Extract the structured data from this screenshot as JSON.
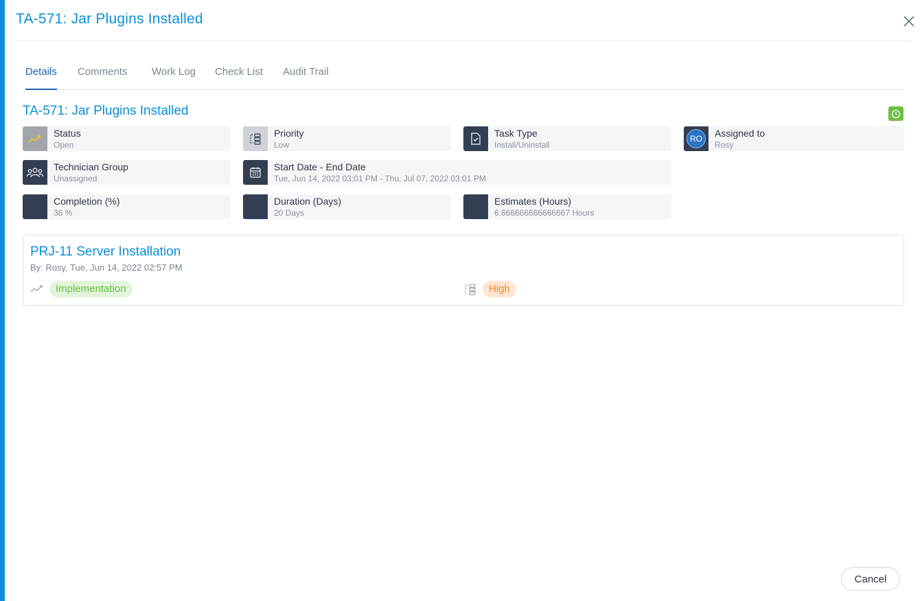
{
  "modal": {
    "title": "TA-571: Jar Plugins Installed"
  },
  "tabs": [
    {
      "label": "Details"
    },
    {
      "label": "Comments"
    },
    {
      "label": "Work Log"
    },
    {
      "label": "Check List"
    },
    {
      "label": "Audit Trail"
    }
  ],
  "task": {
    "title": "TA-571: Jar Plugins Installed",
    "fields": {
      "status": {
        "label": "Status",
        "value": "Open",
        "icon": "trend-icon"
      },
      "priority": {
        "label": "Priority",
        "value": "Low",
        "icon": "priority-icon"
      },
      "task_type": {
        "label": "Task Type",
        "value": "Install/Uninstall",
        "icon": "document-check-icon"
      },
      "assigned_to": {
        "label": "Assigned to",
        "value": "Rosy",
        "avatar": "RO"
      },
      "technician_group": {
        "label": "Technician Group",
        "value": "Unassigned",
        "icon": "group-icon"
      },
      "dates": {
        "label": "Start Date - End Date",
        "value": "Tue, Jun 14, 2022 03:01 PM - Thu, Jul 07, 2022 03:01 PM",
        "icon": "calendar-icon"
      },
      "completion": {
        "label": "Completion (%)",
        "value": "36 %"
      },
      "duration": {
        "label": "Duration (Days)",
        "value": "20 Days"
      },
      "estimates": {
        "label": "Estimates (Hours)",
        "value": "6.666666666666667 Hours"
      }
    }
  },
  "project": {
    "title": "PRJ-11 Server Installation",
    "meta": "By: Rosy, Tue, Jun 14, 2022 02:57 PM",
    "stage": "Implementation",
    "priority": "High"
  },
  "footer": {
    "cancel_label": "Cancel"
  },
  "colors": {
    "accent": "#0a8fd8",
    "tab_active": "#1f5fae",
    "icon_dark": "#323e52",
    "timer_green": "#6abf45",
    "impl_bg": "#e2f4da",
    "impl_fg": "#6abf45",
    "high_bg": "#fde6d3",
    "high_fg": "#f0892e"
  }
}
